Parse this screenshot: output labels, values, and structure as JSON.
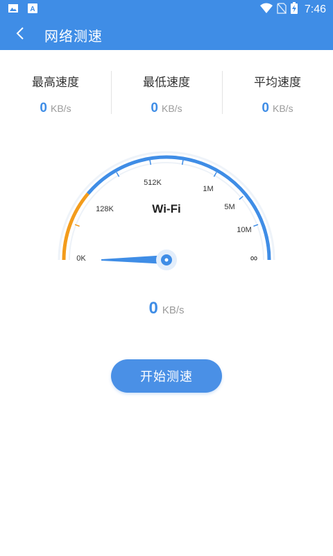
{
  "status_bar": {
    "time": "7:46",
    "left_icons": [
      "image-icon",
      "text-a-icon"
    ],
    "right_icons": [
      "wifi-icon",
      "no-sim-icon",
      "battery-charging-icon"
    ]
  },
  "app_bar": {
    "title": "网络测速",
    "back_icon": "chevron-left-icon"
  },
  "stats": [
    {
      "label": "最高速度",
      "value": "0",
      "unit": "KB/s"
    },
    {
      "label": "最低速度",
      "value": "0",
      "unit": "KB/s"
    },
    {
      "label": "平均速度",
      "value": "0",
      "unit": "KB/s"
    }
  ],
  "gauge": {
    "network_type": "Wi-Fi",
    "scale_labels": [
      "0K",
      "128K",
      "512K",
      "1M",
      "5M",
      "10M",
      "∞"
    ],
    "current_level": 0,
    "accent_color": "#3f8de6",
    "low_color": "#f39c1c"
  },
  "current_speed": {
    "value": "0",
    "unit": "KB/s"
  },
  "start_button": {
    "label": "开始测速"
  }
}
